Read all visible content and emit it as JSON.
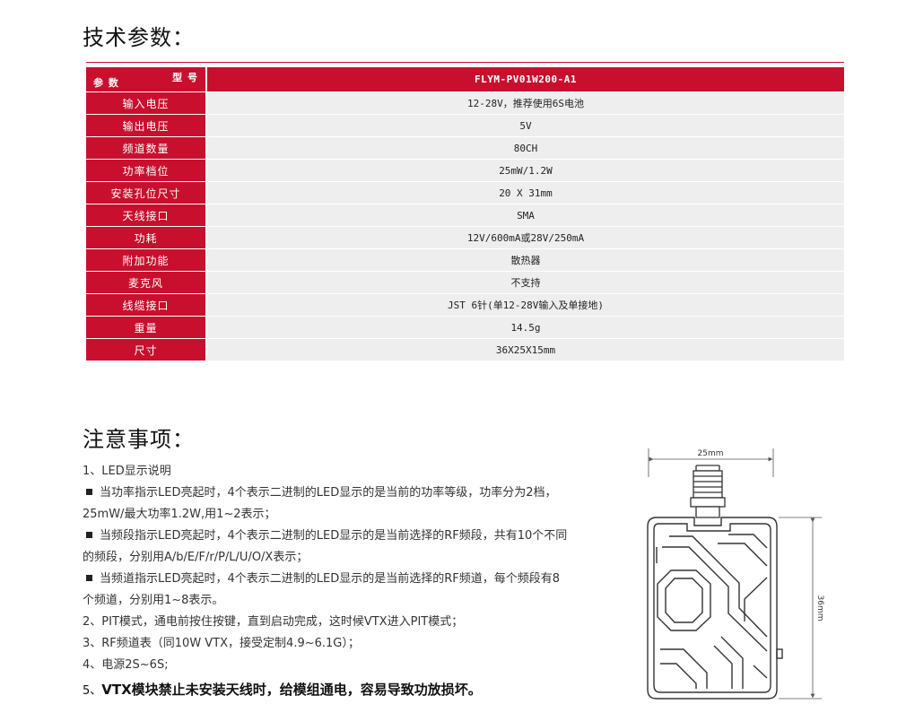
{
  "spec_section": {
    "title": "技术参数：",
    "header": {
      "model_label": "型 号",
      "param_label": "参 数",
      "model": "FLYM-PV01W200-A1"
    },
    "rows": [
      {
        "param": "输入电压",
        "value": "12-28V，推荐使用6S电池"
      },
      {
        "param": "输出电压",
        "value": "5V"
      },
      {
        "param": "频道数量",
        "value": "80CH"
      },
      {
        "param": "功率档位",
        "value": "25mW/1.2W"
      },
      {
        "param": "安装孔位尺寸",
        "value": "20 X 31mm"
      },
      {
        "param": "天线接口",
        "value": "SMA"
      },
      {
        "param": "功耗",
        "value": "12V/600mA或28V/250mA"
      },
      {
        "param": "附加功能",
        "value": "散热器"
      },
      {
        "param": "麦克风",
        "value": "不支持"
      },
      {
        "param": "线缆接口",
        "value": "JST 6针(单12-28V输入及单接地)"
      },
      {
        "param": "重量",
        "value": "14.5g"
      },
      {
        "param": "尺寸",
        "value": "36X25X15mm"
      }
    ]
  },
  "notes_section": {
    "title": "注意事项：",
    "items": {
      "led_title": "1、LED显示说明",
      "bullet1_a": "当功率指示LED亮起时，4个表示二进制的LED显示的是当前的功率等级，功率分为2档，",
      "bullet1_b": "25mW/最大功率1.2W,用1~2表示；",
      "bullet2_a": "当频段指示LED亮起时，4个表示二进制的LED显示的是当前选择的RF频段，共有10个不同",
      "bullet2_b": "的频段，分别用A/b/E/F/r/P/L/U/O/X表示；",
      "bullet3_a": "当频道指示LED亮起时，4个表示二进制的LED显示的是当前选择的RF频道，每个频段有8",
      "bullet3_b": "个频道，分别用1~8表示。",
      "pit": "2、PIT模式，通电前按住按键，直到启动完成，这时候VTX进入PIT模式；",
      "rf": "3、RF频道表（同10W VTX，接受定制4.9~6.1G）；",
      "power": "4、电源2S~6S;",
      "warn_num": "5、",
      "warn": "VTX模块禁止未安装天线时，给模组通电，容易导致功放损坏。"
    }
  },
  "drawing": {
    "width_label": "25mm",
    "height_label": "36mm"
  }
}
